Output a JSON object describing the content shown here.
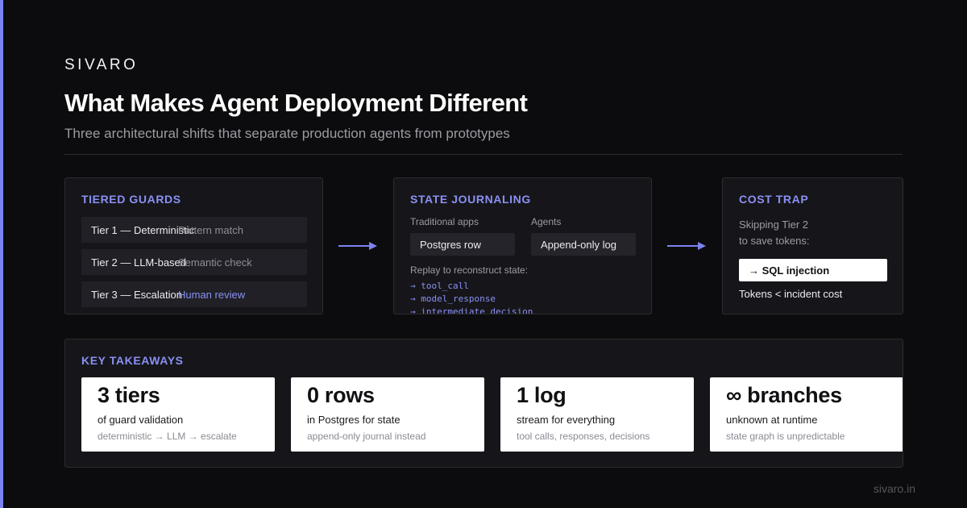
{
  "brand": "SIVARO",
  "title": "What Makes Agent Deployment Different",
  "subtitle": "Three architectural shifts that separate production agents from prototypes",
  "colors": {
    "accent": "#7b83f0",
    "background": "#0c0c0e",
    "card": "#16161a"
  },
  "tiered_guards": {
    "title": "TIERED GUARDS",
    "tiers": [
      {
        "name": "Tier 1 — Deterministic",
        "desc": "Pattern match"
      },
      {
        "name": "Tier 2 — LLM-based",
        "desc": "Semantic check"
      },
      {
        "name": "Tier 3 — Escalation",
        "desc": "Human review"
      }
    ]
  },
  "state_journaling": {
    "title": "STATE JOURNALING",
    "traditional_label": "Traditional apps",
    "traditional_value": "Postgres row",
    "agents_label": "Agents",
    "agents_value": "Append-only log",
    "replay_label": "Replay to reconstruct state:",
    "log_entries": [
      "→ tool_call",
      "→ model_response",
      "→ intermediate_decision"
    ]
  },
  "cost_trap": {
    "title": "COST TRAP",
    "line1": "Skipping Tier 2",
    "line2": "to save tokens:",
    "highlight": "→ SQL injection",
    "note": "Tokens < incident cost"
  },
  "takeaways": {
    "title": "KEY TAKEAWAYS",
    "items": [
      {
        "number": "3 tiers",
        "label": "of guard validation",
        "sub": "deterministic → LLM → escalate"
      },
      {
        "number": "0 rows",
        "label": "in Postgres for state",
        "sub": "append-only journal instead"
      },
      {
        "number": "1 log",
        "label": "stream for everything",
        "sub": "tool calls, responses, decisions"
      },
      {
        "number": "∞ branches",
        "label": "unknown at runtime",
        "sub": "state graph is unpredictable"
      }
    ]
  },
  "footer": "sivaro.in"
}
